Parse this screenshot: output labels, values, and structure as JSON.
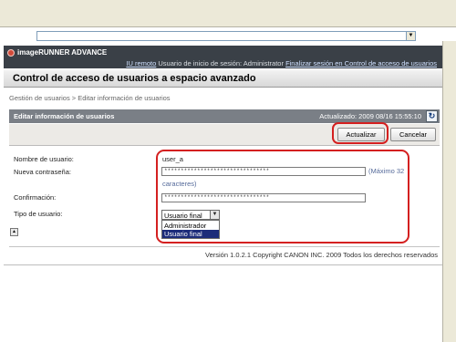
{
  "browser": {
    "address_value": ""
  },
  "header": {
    "product_name": "imageRUNNER ADVANCE",
    "remote_ui_link": "IU remoto",
    "login_user": "Usuario de inicio de sesión: Administrator",
    "logout_link": "Finalizar sesión en Control de acceso de usuarios"
  },
  "page": {
    "title": "Control de acceso de usuarios a espacio avanzado",
    "breadcrumb": "Gestión de usuarios > Editar información de usuarios"
  },
  "panel": {
    "title": "Editar información de usuarios",
    "updated": "Actualizado: 2009 08/16 15:55:10",
    "refresh_icon": "refresh-icon"
  },
  "buttons": {
    "update": "Actualizar",
    "cancel": "Cancelar"
  },
  "form": {
    "username_label": "Nombre de usuario:",
    "username_value": "user_a",
    "new_password_label": "Nueva contraseña:",
    "new_password_value": "********************************",
    "new_password_hint_1": "(Máximo 32",
    "new_password_hint_2": "caracteres)",
    "confirm_label": "Confirmación:",
    "confirm_value": "********************************",
    "user_type_label": "Tipo de usuario:",
    "user_type_selected": "Usuario final",
    "user_type_options": [
      "Administrador",
      "Usuario final"
    ]
  },
  "footer": {
    "copyright": "Versión 1.0.2.1 Copyright CANON INC. 2009 Todos los derechos reservados"
  },
  "colors": {
    "brand_bar": "#3a4047",
    "panel_header": "#7a7f86",
    "highlight": "#d42020",
    "selected_option": "#1c2c7a"
  }
}
